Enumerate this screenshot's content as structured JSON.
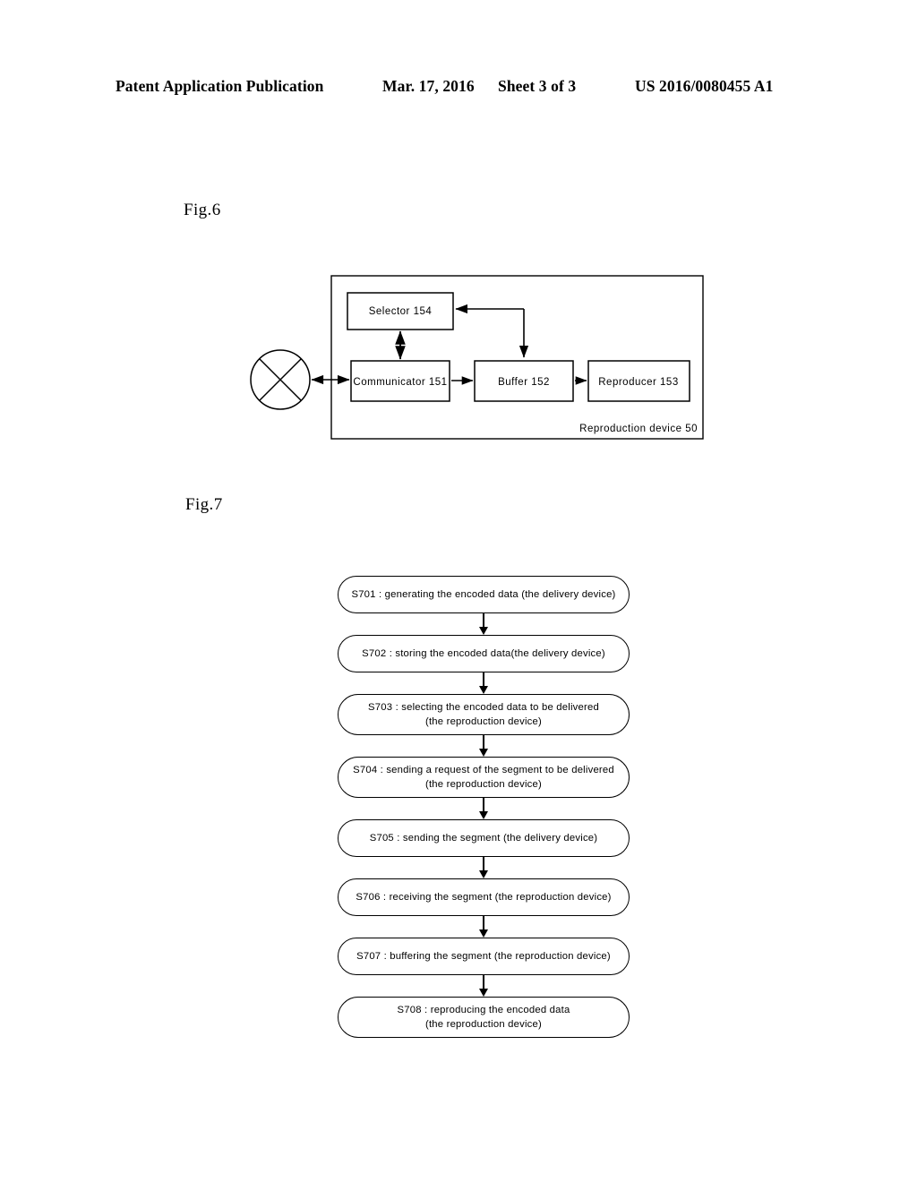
{
  "header": {
    "publication": "Patent Application Publication",
    "date": "Mar. 17, 2016",
    "sheet": "Sheet 3 of 3",
    "patent_number": "US 2016/0080455 A1"
  },
  "fig6": {
    "label": "Fig.6",
    "container_label": "Reproduction device 50",
    "blocks": [
      {
        "id": "selector",
        "label": "Selector 154"
      },
      {
        "id": "communicator",
        "label": "Communicator 151"
      },
      {
        "id": "buffer",
        "label": "Buffer 152"
      },
      {
        "id": "reproducer",
        "label": "Reproducer 153"
      }
    ],
    "network_symbol": "circle-with-x-network-icon"
  },
  "fig7": {
    "label": "Fig.7",
    "steps": [
      {
        "id": "s701",
        "lines": [
          "S701 : generating the encoded data (the delivery device)"
        ]
      },
      {
        "id": "s702",
        "lines": [
          "S702 : storing the encoded data(the delivery device)"
        ]
      },
      {
        "id": "s703",
        "lines": [
          "S703 : selecting the encoded data to be delivered",
          "(the reproduction device)"
        ]
      },
      {
        "id": "s704",
        "lines": [
          "S704 : sending a request of the segment to be delivered",
          "(the reproduction device)"
        ]
      },
      {
        "id": "s705",
        "lines": [
          "S705 : sending the segment (the delivery device)"
        ]
      },
      {
        "id": "s706",
        "lines": [
          "S706 : receiving the segment (the reproduction device)"
        ]
      },
      {
        "id": "s707",
        "lines": [
          "S707 : buffering the segment (the reproduction device)"
        ]
      },
      {
        "id": "s708",
        "lines": [
          "S708 : reproducing the encoded data",
          "(the reproduction device)"
        ]
      }
    ]
  }
}
